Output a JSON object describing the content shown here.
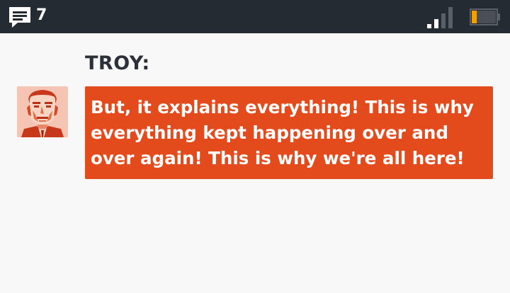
{
  "status_bar": {
    "chat_icon": "chat-bubble-icon",
    "unread_count": "7",
    "signal_icon": "signal-strength-icon",
    "battery_icon": "battery-low-icon",
    "battery_level": 0.2,
    "battery_color": "#f0a000"
  },
  "dialogue": {
    "speaker": "TROY:",
    "portrait_icon": "troy-portrait",
    "message": "But, it explains everything! This is why everything kept happening over and over again! This is why we're all here!"
  },
  "colors": {
    "status_bar_bg": "#252b33",
    "page_bg": "#f8f8f8",
    "bubble_bg": "#e34b1d",
    "speaker_text": "#2c3038"
  }
}
